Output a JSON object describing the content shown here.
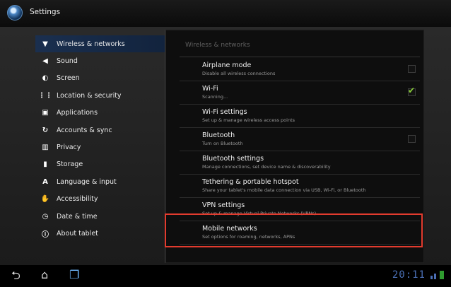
{
  "titlebar": {
    "title": "Settings"
  },
  "sidebar": {
    "items": [
      {
        "label": "Wireless & networks",
        "icon": "wireless-icon",
        "selected": true
      },
      {
        "label": "Sound",
        "icon": "sound-icon"
      },
      {
        "label": "Screen",
        "icon": "screen-icon"
      },
      {
        "label": "Location & security",
        "icon": "location-security-icon"
      },
      {
        "label": "Applications",
        "icon": "applications-icon"
      },
      {
        "label": "Accounts & sync",
        "icon": "sync-icon"
      },
      {
        "label": "Privacy",
        "icon": "privacy-icon"
      },
      {
        "label": "Storage",
        "icon": "storage-icon"
      },
      {
        "label": "Language & input",
        "icon": "language-icon"
      },
      {
        "label": "Accessibility",
        "icon": "accessibility-icon"
      },
      {
        "label": "Date & time",
        "icon": "clock-icon"
      },
      {
        "label": "About tablet",
        "icon": "info-icon"
      }
    ]
  },
  "panel": {
    "header": "Wireless & networks",
    "rows": [
      {
        "title": "Airplane mode",
        "subtitle": "Disable all wireless connections",
        "checkbox": true,
        "checked": false
      },
      {
        "title": "Wi-Fi",
        "subtitle": "Scanning...",
        "checkbox": true,
        "checked": true
      },
      {
        "title": "Wi-Fi settings",
        "subtitle": "Set up & manage wireless access points",
        "checkbox": false
      },
      {
        "title": "Bluetooth",
        "subtitle": "Turn on Bluetooth",
        "checkbox": true,
        "checked": false
      },
      {
        "title": "Bluetooth settings",
        "subtitle": "Manage connections, set device name & discoverability",
        "checkbox": false
      },
      {
        "title": "Tethering & portable hotspot",
        "subtitle": "Share your tablet's mobile data connection via USB, Wi-Fi, or Bluetooth",
        "checkbox": false
      },
      {
        "title": "VPN settings",
        "subtitle": "Set up & manage Virtual Private Networks (VPNs)",
        "checkbox": false
      },
      {
        "title": "Mobile networks",
        "subtitle": "Set options for roaming, networks, APNs",
        "checkbox": false,
        "highlighted": true
      }
    ]
  },
  "navbar": {
    "clock": "20:11",
    "icons": [
      "back-icon",
      "home-icon",
      "recent-apps-icon",
      "signal-icon",
      "battery-icon"
    ]
  },
  "colors": {
    "highlight": "#e23b2e",
    "selected": "#1a2f4f",
    "check": "#8bd13a",
    "clock": "#4a6fb4"
  }
}
